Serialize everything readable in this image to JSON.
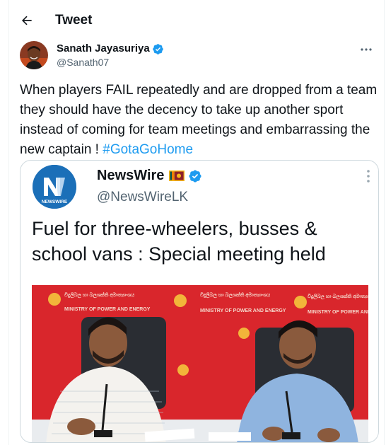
{
  "header": {
    "title": "Tweet",
    "back_icon": "arrow-left-icon"
  },
  "author": {
    "display_name": "Sanath Jayasuriya",
    "handle": "@Sanath07",
    "verified_icon": "verified-badge-icon"
  },
  "tweet": {
    "text_before": "When players FAIL repeatedly and are dropped from a team they should have the decency to take up another sport instead of coming for team meetings and embarrassing the new captain ! ",
    "hashtag": "#GotaGoHome"
  },
  "embedded": {
    "display_name": "NewsWire",
    "handle": "@NewsWireLK",
    "logo_text": "NEWSWIRE",
    "headline": "Fuel for three-wheelers, busses & school vans : Special meeting held",
    "backdrop_lines": [
      "විදුලිබල හා බලශක්ති අමාත්‍යාංශය",
      "MINISTRY OF POWER AND ENERGY"
    ]
  },
  "colors": {
    "accent": "#1d9bf0",
    "text": "#0f1419",
    "muted": "#536471",
    "backdrop": "#d9262c"
  }
}
